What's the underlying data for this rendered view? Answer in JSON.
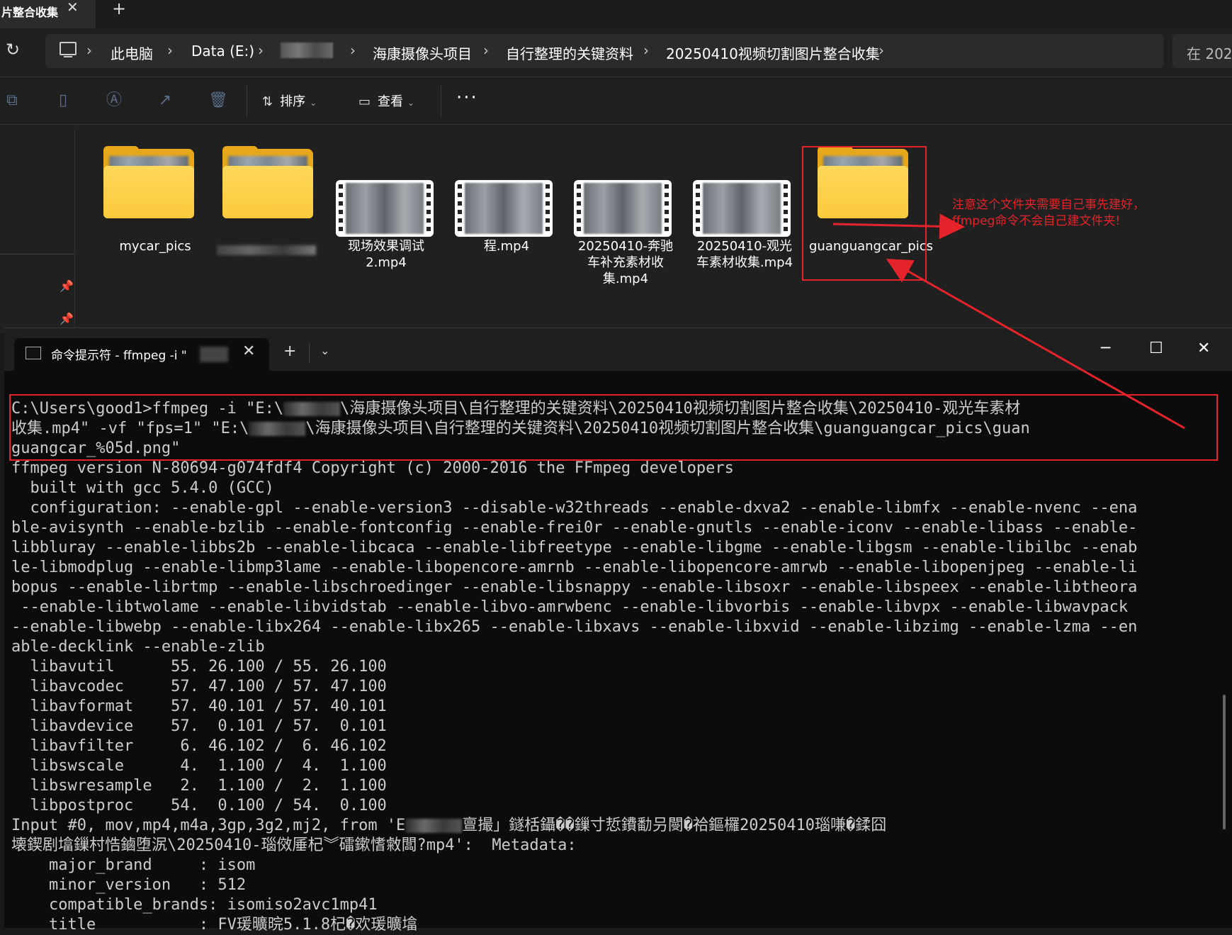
{
  "explorer": {
    "tab": {
      "title": "片整合收集",
      "close": "✕",
      "new": "+"
    },
    "address": {
      "refresh": "↻",
      "crumbs": [
        "此电脑",
        "Data (E:)",
        "海康摄像头项目",
        "自行整理的关键资料",
        "20250410视频切割图片整合收集"
      ],
      "sep": "›",
      "search_text": "在 202"
    },
    "toolbar": {
      "sort_label": "排序",
      "view_label": "查看",
      "more": "···"
    },
    "files": [
      {
        "type": "folder",
        "label": "mycar_pics"
      },
      {
        "type": "folder",
        "label": ""
      },
      {
        "type": "video",
        "label": "现场效果调试2.mp4"
      },
      {
        "type": "video",
        "label": "程.mp4"
      },
      {
        "type": "video",
        "label": "20250410-奔驰车补充素材收集.mp4"
      },
      {
        "type": "video",
        "label": "20250410-观光车素材收集.mp4"
      },
      {
        "type": "folder",
        "label": "guanguangcar_pics"
      }
    ],
    "note_line1": "注意这个文件夹需要自己事先建好，",
    "note_line2": "ffmpeg命令不会自己建文件夹!",
    "accent_color": "#e5232a"
  },
  "terminal": {
    "tab_title": "命令提示符 - ffmpeg  -i \"",
    "close": "✕",
    "new": "+",
    "dropdown": "⌄",
    "minimize": "─",
    "maximize": "☐",
    "window_close": "✕",
    "lines": [
      [
        "C:\\Users\\good1>ffmpeg -i \"E:\\",
        "\\海康摄像头项目\\自行整理的关键资料\\20250410视频切割图片整合收集\\20250410-观光车素材"
      ],
      [
        "收集.mp4\" -vf \"fps=1\" \"E:\\",
        "\\海康摄像头项目\\自行整理的关键资料\\20250410视频切割图片整合收集\\guanguangcar_pics\\guan"
      ],
      [
        "guangcar_%05d.png\""
      ],
      [
        "ffmpeg version N-80694-g074fdf4 Copyright (c) 2000-2016 the FFmpeg developers"
      ],
      [
        "  built with gcc 5.4.0 (GCC)"
      ],
      [
        "  configuration: --enable-gpl --enable-version3 --disable-w32threads --enable-dxva2 --enable-libmfx --enable-nvenc --ena"
      ],
      [
        "ble-avisynth --enable-bzlib --enable-fontconfig --enable-frei0r --enable-gnutls --enable-iconv --enable-libass --enable-"
      ],
      [
        "libbluray --enable-libbs2b --enable-libcaca --enable-libfreetype --enable-libgme --enable-libgsm --enable-libilbc --enab"
      ],
      [
        "le-libmodplug --enable-libmp3lame --enable-libopencore-amrnb --enable-libopencore-amrwb --enable-libopenjpeg --enable-li"
      ],
      [
        "bopus --enable-librtmp --enable-libschroedinger --enable-libsnappy --enable-libsoxr --enable-libspeex --enable-libtheora"
      ],
      [
        " --enable-libtwolame --enable-libvidstab --enable-libvo-amrwbenc --enable-libvorbis --enable-libvpx --enable-libwavpack"
      ],
      [
        "--enable-libwebp --enable-libx264 --enable-libx265 --enable-libxavs --enable-libxvid --enable-libzimg --enable-lzma --en"
      ],
      [
        "able-decklink --enable-zlib"
      ],
      [
        "  libavutil      55. 26.100 / 55. 26.100"
      ],
      [
        "  libavcodec     57. 47.100 / 57. 47.100"
      ],
      [
        "  libavformat    57. 40.101 / 57. 40.101"
      ],
      [
        "  libavdevice    57.  0.101 / 57.  0.101"
      ],
      [
        "  libavfilter     6. 46.102 /  6. 46.102"
      ],
      [
        "  libswscale      4.  1.100 /  4.  1.100"
      ],
      [
        "  libswresample   2.  1.100 /  2.  1.100"
      ],
      [
        "  libpostproc    54.  0.100 / 54.  0.100"
      ],
      [
        "Input #0, mov,mp4,m4a,3gp,3g2,mj2, from 'E",
        "亶撮」鐩栝鑷��鏁寸悊鐨勫叧閿�祫鏂欏20250410瑙嗛�鍒囧"
      ],
      [
        "壊鍥剧墖鏁村悎鏀堕泦\\20250410-瑙傚厜杞︾礌鏉愭敹闆?mp4':  Metadata:"
      ],
      [
        "    major_brand     : isom"
      ],
      [
        "    minor_version   : 512"
      ],
      [
        "    compatible_brands: isomiso2avc1mp41"
      ],
      [
        "    title           : FV瑗曠晥5.1.8杞�欢瑗曠墖"
      ]
    ]
  }
}
